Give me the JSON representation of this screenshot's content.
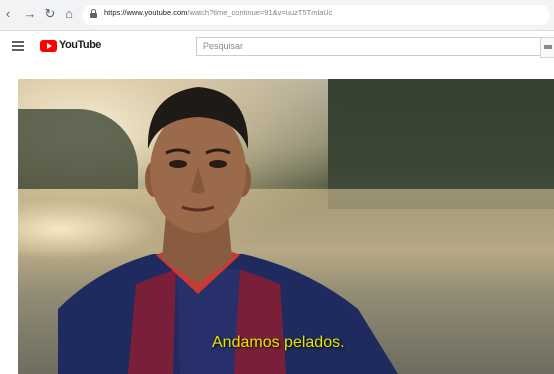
{
  "browser": {
    "back_icon": "back-arrow-icon",
    "forward_icon": "forward-arrow-icon",
    "reload_icon": "reload-icon",
    "home_icon": "home-icon",
    "url_host": "https://www.youtube.com",
    "url_path": "/watch?time_continue=91&v=uuzT5TmlaUc"
  },
  "youtube": {
    "menu_icon": "hamburger-menu-icon",
    "logo_text": "YouTube",
    "search_placeholder": "Pesquisar"
  },
  "video": {
    "subtitle": "Andamos pelados."
  },
  "colors": {
    "youtube_red": "#ff0000",
    "subtitle_yellow": "#e6e600"
  }
}
